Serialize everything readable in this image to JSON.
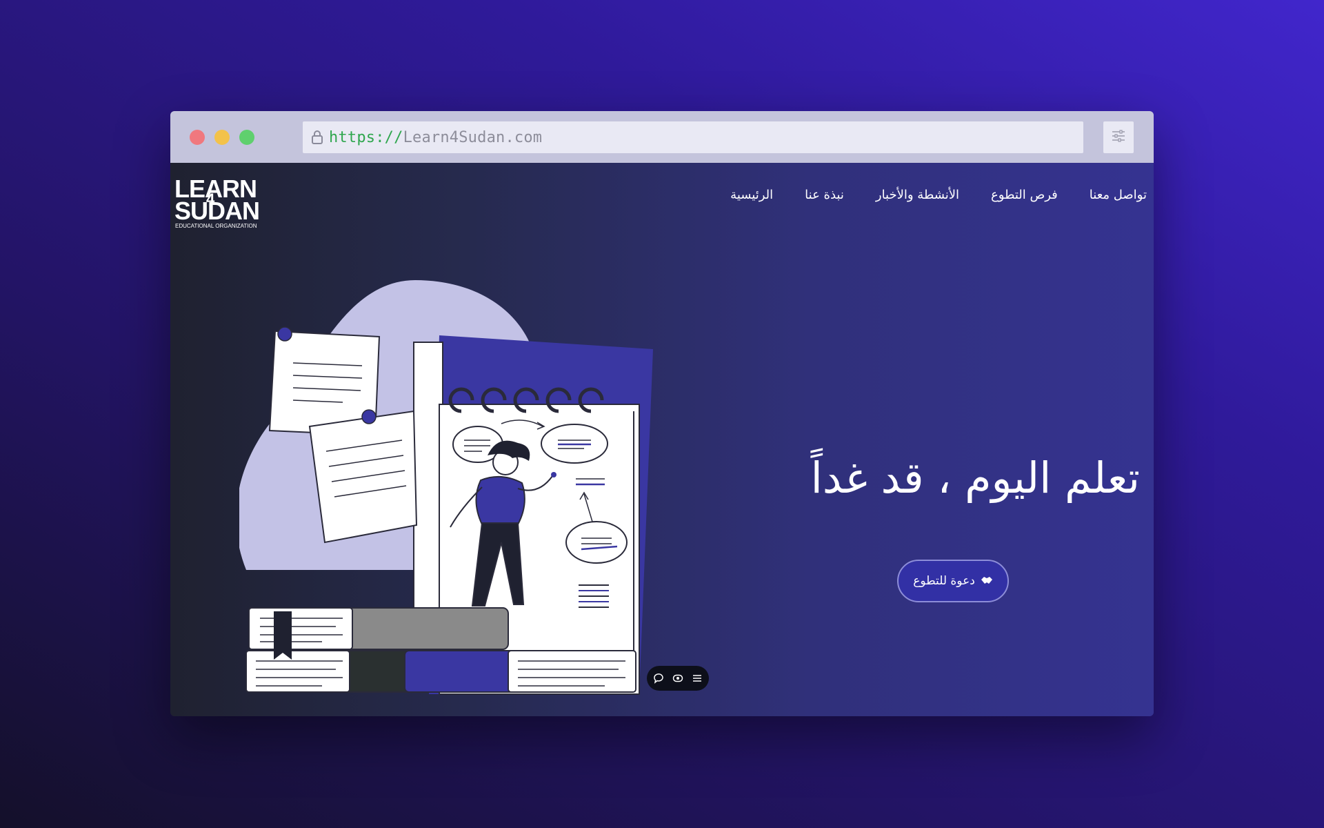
{
  "browser": {
    "url_scheme": "https://",
    "url_host": "Learn4Sudan.com",
    "icons": [
      "lock-icon",
      "sliders-icon"
    ]
  },
  "logo": {
    "line1": "LEARN",
    "digit": "4",
    "line2": "SUDAN",
    "tagline": "EDUCATIONAL ORGANIZATION"
  },
  "nav": {
    "items": [
      {
        "label": "الرئيسية"
      },
      {
        "label": "نبذة عنا"
      },
      {
        "label": "الأنشطة والأخبار"
      },
      {
        "label": "فرص التطوع"
      },
      {
        "label": "تواصل معنا"
      }
    ]
  },
  "hero": {
    "title": "تعلم اليوم ، قد غداً",
    "cta_label": "دعوة للتطوع",
    "cta_icon": "handshake-icon"
  },
  "widget": {
    "icons": [
      "chat-icon",
      "eye-icon",
      "menu-icon"
    ]
  },
  "colors": {
    "accent": "#3230a5",
    "blob": "#c3c2e6",
    "panel": "#3a37a2"
  }
}
